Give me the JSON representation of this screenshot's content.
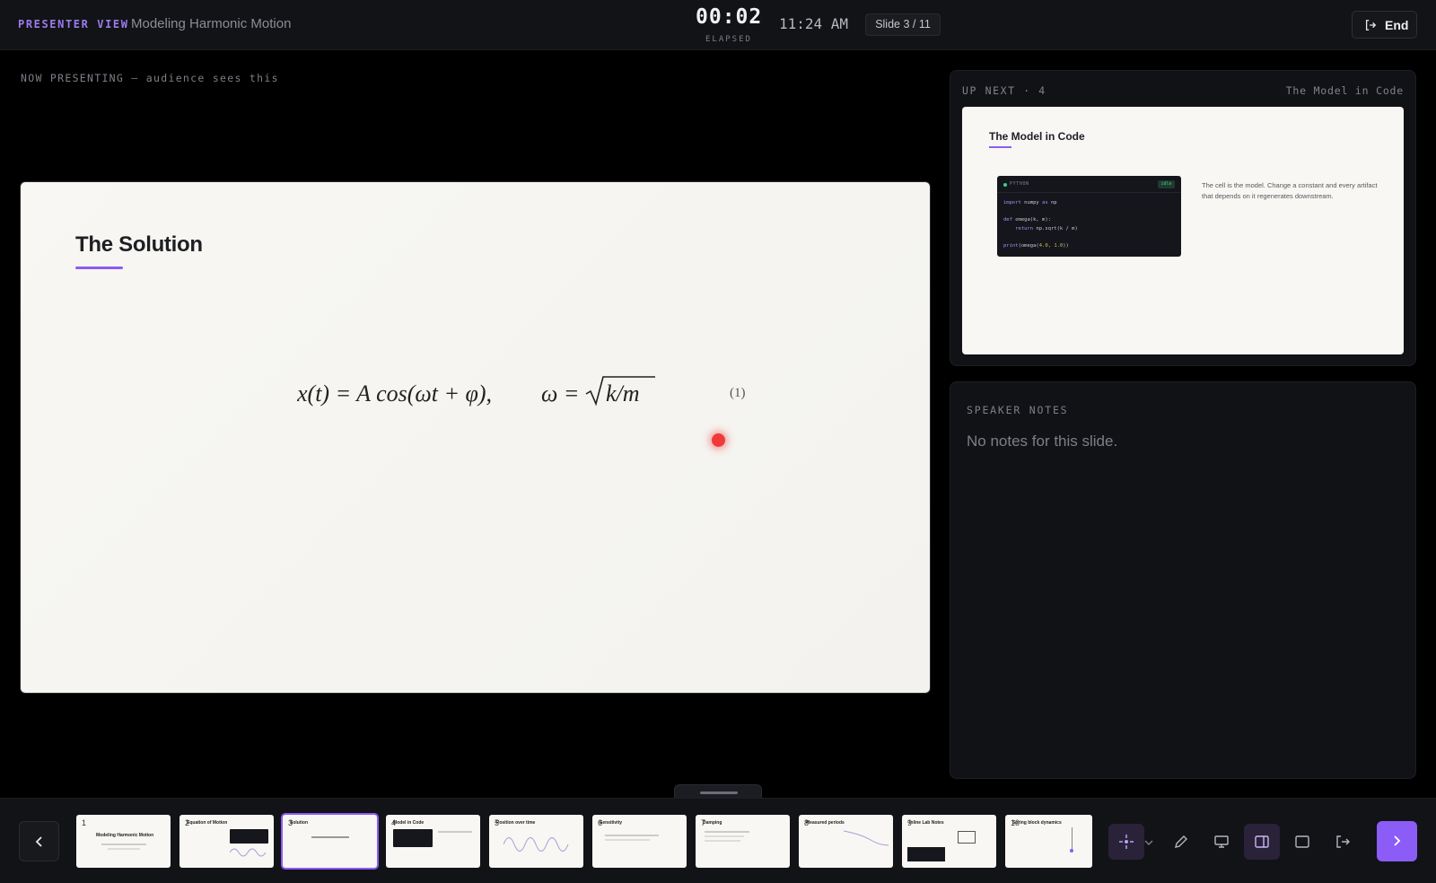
{
  "header": {
    "mode_label": "PRESENTER VIEW",
    "deck_title": "Modeling Harmonic Motion",
    "elapsed": "00:02",
    "elapsed_label": "ELAPSED",
    "clock": "11:24 AM",
    "slide_counter": "Slide 3 / 11",
    "end_label": "End"
  },
  "current": {
    "label": "NOW PRESENTING — audience sees this",
    "title": "The Solution",
    "equation_number": "(1)"
  },
  "next": {
    "label": "UP NEXT · 4",
    "name": "The Model in Code",
    "title": "The Model in Code",
    "code_lang": "PYTHON",
    "code_badge": "idle",
    "description": "The cell is the model. Change a constant and every artifact that depends on it regenerates downstream."
  },
  "notes": {
    "label": "SPEAKER NOTES",
    "text": "No notes for this slide."
  },
  "thumbnails": [
    {
      "n": "1",
      "title": "Modeling Harmonic Motion"
    },
    {
      "n": "2",
      "title": "Equation of Motion"
    },
    {
      "n": "3",
      "title": "Solution"
    },
    {
      "n": "4",
      "title": "Model in Code"
    },
    {
      "n": "5",
      "title": "Position over time"
    },
    {
      "n": "6",
      "title": "Sensitivity"
    },
    {
      "n": "7",
      "title": "Damping"
    },
    {
      "n": "8",
      "title": "Measured periods"
    },
    {
      "n": "9",
      "title": "Inline Lab Notes"
    },
    {
      "n": "10",
      "title": "Spring block dynamics"
    }
  ],
  "active_slide": "3",
  "colors": {
    "accent": "#8b5cf6",
    "laser": "#f03a3a",
    "background": "#000000"
  },
  "icons": {
    "prev": "chevron-left-icon",
    "next": "chevron-right-icon",
    "laser": "laser-pointer-icon",
    "pen": "pen-icon",
    "monitor": "monitor-icon",
    "split": "split-view-icon",
    "blank": "blank-screen-icon",
    "exit": "exit-icon"
  }
}
